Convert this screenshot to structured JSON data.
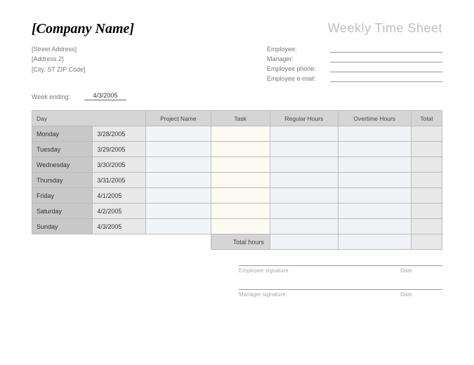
{
  "header": {
    "company_name": "[Company Name]",
    "title": "Weekly Time Sheet"
  },
  "address": {
    "street": "[Street Address]",
    "address2": "[Address 2]",
    "city_st_zip": "[City, ST  ZIP Code]"
  },
  "employee_fields": {
    "employee_label": "Employee:",
    "manager_label": "Manager:",
    "phone_label": "Employee phone:",
    "email_label": "Employee e-mail:"
  },
  "week_ending": {
    "label": "Week ending:",
    "value": "4/3/2005"
  },
  "columns": {
    "day": "Day",
    "project": "Project Name",
    "task": "Task",
    "regular": "Regular Hours",
    "overtime": "Overtime Hours",
    "total": "Total"
  },
  "rows": [
    {
      "day": "Monday",
      "date": "3/28/2005"
    },
    {
      "day": "Tuesday",
      "date": "3/29/2005"
    },
    {
      "day": "Wednesday",
      "date": "3/30/2005"
    },
    {
      "day": "Thursday",
      "date": "3/31/2005"
    },
    {
      "day": "Friday",
      "date": "4/1/2005"
    },
    {
      "day": "Saturday",
      "date": "4/2/2005"
    },
    {
      "day": "Sunday",
      "date": "4/3/2005"
    }
  ],
  "totals": {
    "label": "Total hours"
  },
  "signatures": {
    "employee": "Employee signature",
    "manager": "Manager signature",
    "date": "Date"
  }
}
